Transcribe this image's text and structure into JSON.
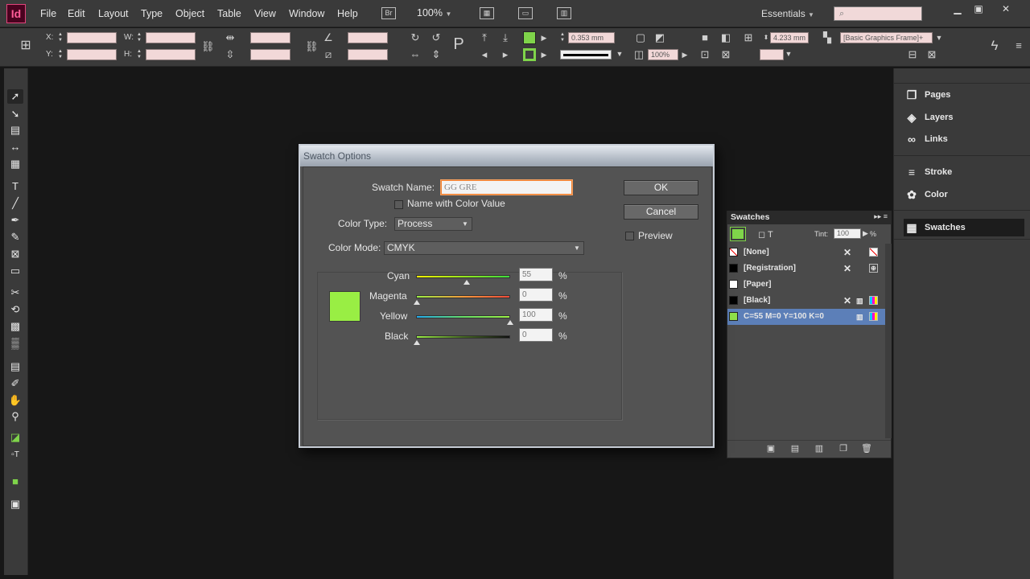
{
  "app": {
    "logo": "Id"
  },
  "menu": [
    "File",
    "Edit",
    "Layout",
    "Type",
    "Object",
    "Table",
    "View",
    "Window",
    "Help"
  ],
  "menubar": {
    "bridge_label": "Br",
    "zoom": "100%",
    "workspace": "Essentials"
  },
  "control": {
    "x_label": "X:",
    "y_label": "Y:",
    "w_label": "W:",
    "h_label": "H:",
    "stroke_weight": "0.353 mm",
    "opacity": "100%",
    "fx_size": "4.233 mm",
    "object_style": "[Basic Graphics Frame]+"
  },
  "dock": {
    "items": [
      {
        "label": "Pages",
        "icon": "pages-icon"
      },
      {
        "label": "Layers",
        "icon": "layers-icon"
      },
      {
        "label": "Links",
        "icon": "links-icon"
      },
      {
        "label": "Stroke",
        "icon": "stroke-icon"
      },
      {
        "label": "Color",
        "icon": "color-icon"
      },
      {
        "label": "Swatches",
        "icon": "swatches-icon"
      }
    ]
  },
  "swatches_panel": {
    "title": "Swatches",
    "tint_label": "Tint:",
    "tint_value": "100",
    "tint_unit": "%",
    "rows": [
      {
        "name": "[None]",
        "color": "#ffffff"
      },
      {
        "name": "[Registration]",
        "color": "#000000"
      },
      {
        "name": "[Paper]",
        "color": "#ffffff"
      },
      {
        "name": "[Black]",
        "color": "#000000"
      },
      {
        "name": "C=55 M=0 Y=100 K=0",
        "color": "#8fe04a"
      }
    ]
  },
  "dialog": {
    "title": "Swatch Options",
    "swatch_name_label": "Swatch Name:",
    "swatch_name_value": "GG GRE",
    "name_with_color_value": "Name with Color Value",
    "color_type_label": "Color Type:",
    "color_type_value": "Process",
    "color_mode_label": "Color Mode:",
    "color_mode_value": "CMYK",
    "ok": "OK",
    "cancel": "Cancel",
    "preview": "Preview",
    "swatch_color": "#99ee44",
    "channels": [
      {
        "label": "Cyan",
        "value": "55",
        "unit": "%"
      },
      {
        "label": "Magenta",
        "value": "0",
        "unit": "%"
      },
      {
        "label": "Yellow",
        "value": "100",
        "unit": "%"
      },
      {
        "label": "Black",
        "value": "0",
        "unit": "%"
      }
    ]
  }
}
